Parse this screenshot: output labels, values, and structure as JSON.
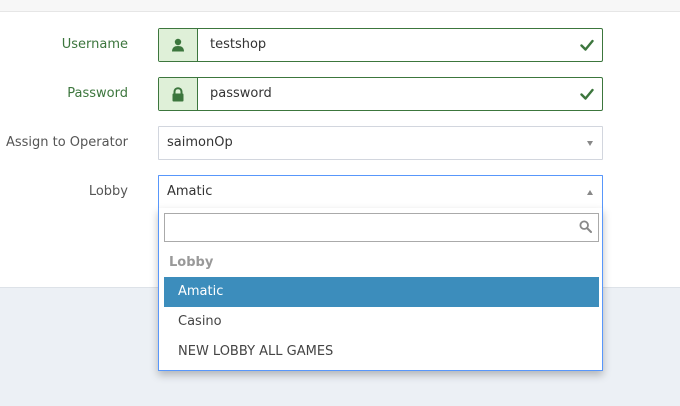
{
  "form": {
    "username": {
      "label": "Username",
      "value": "testshop"
    },
    "password": {
      "label": "Password",
      "value": "password"
    },
    "operator": {
      "label": "Assign to Operator",
      "value": "saimonOp"
    },
    "lobby": {
      "label": "Lobby",
      "value": "Amatic",
      "dropdown": {
        "search_value": "",
        "group_label": "Lobby",
        "options": [
          "Amatic",
          "Casino",
          "NEW LOBBY ALL GAMES"
        ],
        "highlighted_index": 0
      }
    }
  },
  "colors": {
    "success": "#3c763d",
    "success_bg": "#dff0d8",
    "highlight": "#3c8dbc",
    "focus_border": "#5897fb"
  },
  "icons": {
    "username": "user-icon",
    "password": "lock-icon",
    "valid": "check-icon",
    "search": "search-icon",
    "dropdown": "caret-icon"
  }
}
